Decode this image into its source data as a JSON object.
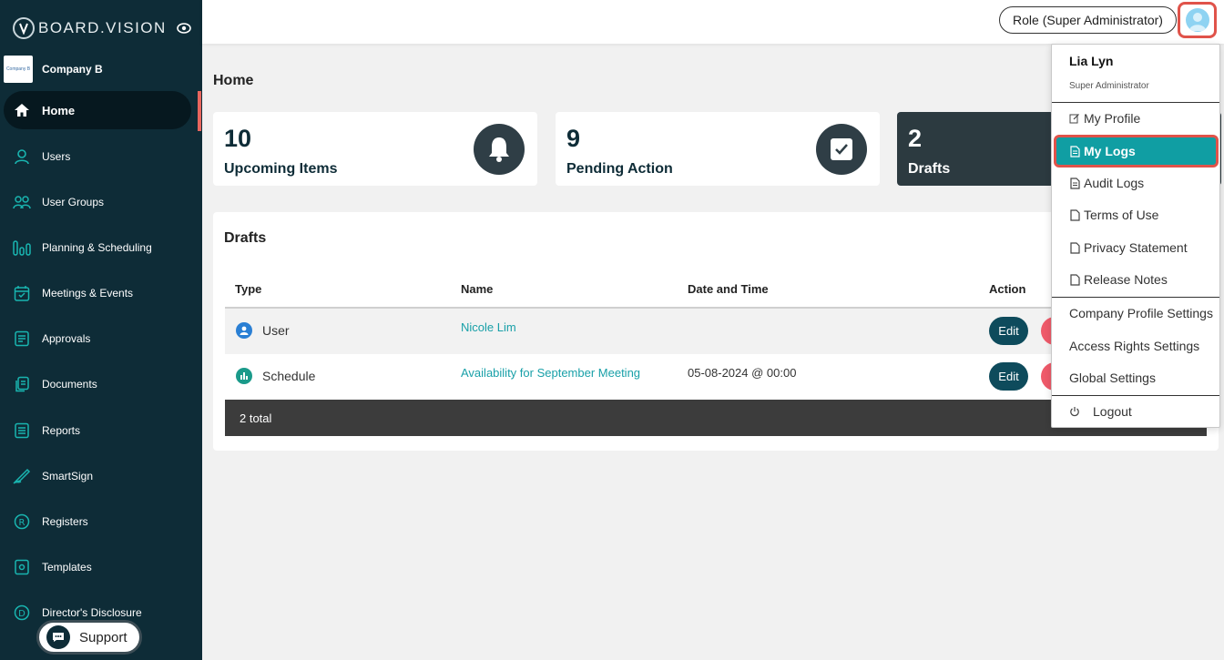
{
  "brand": {
    "logo_text": "BOARD.VISION"
  },
  "company": {
    "name": "Company B",
    "logo_text": "Company B"
  },
  "sidebar": {
    "items": [
      {
        "label": "Home",
        "icon": "home-icon"
      },
      {
        "label": "Users",
        "icon": "user-icon"
      },
      {
        "label": "User Groups",
        "icon": "users-icon"
      },
      {
        "label": "Planning & Scheduling",
        "icon": "bars-icon"
      },
      {
        "label": "Meetings & Events",
        "icon": "calendar-icon"
      },
      {
        "label": "Approvals",
        "icon": "approvals-icon"
      },
      {
        "label": "Documents",
        "icon": "documents-icon"
      },
      {
        "label": "Reports",
        "icon": "reports-icon"
      },
      {
        "label": "SmartSign",
        "icon": "signature-icon"
      },
      {
        "label": "Registers",
        "icon": "registers-icon"
      },
      {
        "label": "Templates",
        "icon": "templates-icon"
      },
      {
        "label": "Director's Disclosure",
        "icon": "disclosure-icon"
      }
    ],
    "active": "Home"
  },
  "support": {
    "label": "Support"
  },
  "topbar": {
    "role_label": "Role (Super Administrator)"
  },
  "main": {
    "title": "Home",
    "cards": [
      {
        "count": "10",
        "label": "Upcoming Items",
        "icon": "bell-icon"
      },
      {
        "count": "9",
        "label": "Pending Action",
        "icon": "checkbox-icon"
      },
      {
        "count": "2",
        "label": "Drafts",
        "icon": "draft-icon"
      }
    ],
    "drafts": {
      "title": "Drafts",
      "columns": [
        "Type",
        "Name",
        "Date and Time",
        "Action"
      ],
      "rows": [
        {
          "type": "User",
          "name": "Nicole Lim",
          "datetime": "",
          "edit": "Edit"
        },
        {
          "type": "Schedule",
          "name": "Availability for September Meeting",
          "datetime": "05-08-2024 @ 00:00",
          "edit": "Edit"
        }
      ],
      "footer": "2 total"
    }
  },
  "user_menu": {
    "name": "Lia Lyn",
    "role": "Super Administrator",
    "items": [
      "My Profile",
      "My Logs",
      "Audit Logs",
      "Terms of Use",
      "Privacy Statement",
      "Release Notes",
      "Company Profile Settings",
      "Access Rights Settings",
      "Global Settings",
      "Logout"
    ],
    "highlighted": "My Logs"
  },
  "colors": {
    "sidebar_bg": "#0e2c37",
    "accent_teal": "#109ea3",
    "highlight_border": "#e0534a",
    "link": "#19a0a8"
  }
}
